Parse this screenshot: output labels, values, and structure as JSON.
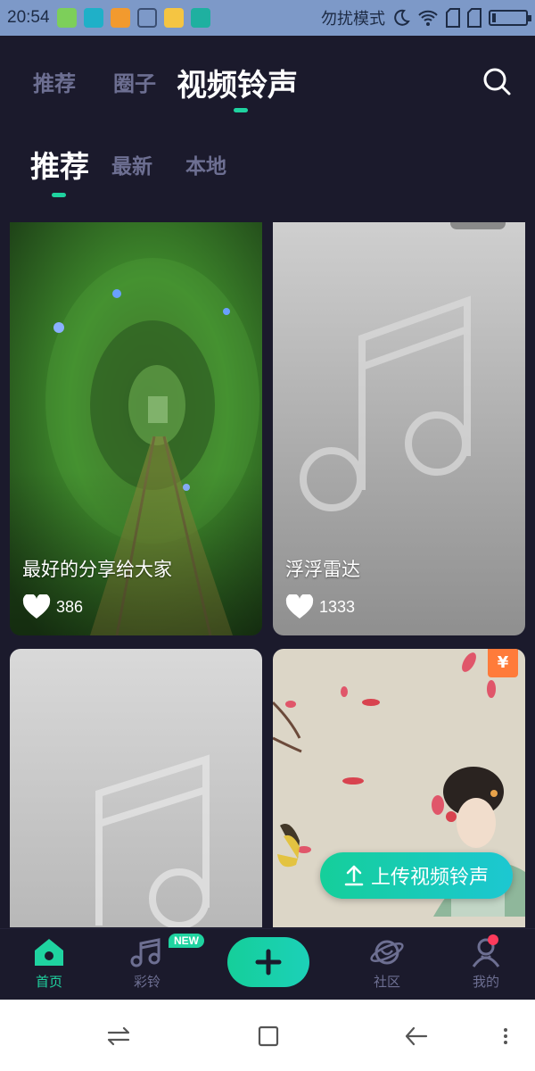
{
  "status_bar": {
    "time": "20:54",
    "dnd_label": "勿扰模式"
  },
  "top_tabs": [
    {
      "label": "推荐"
    },
    {
      "label": "圈子"
    },
    {
      "label": "视频铃声"
    }
  ],
  "sub_tabs": [
    {
      "label": "推荐"
    },
    {
      "label": "最新"
    },
    {
      "label": "本地"
    }
  ],
  "feed": {
    "cards": [
      {
        "title": "最好的分享给大家",
        "likes": "386"
      },
      {
        "title": "浮浮雷达",
        "likes": "1333"
      },
      {
        "title": "",
        "likes": ""
      },
      {
        "title": "",
        "likes": "",
        "price_badge": "¥"
      }
    ]
  },
  "upload_button": {
    "label": "上传视频铃声"
  },
  "bottom_nav": {
    "items": [
      {
        "label": "首页"
      },
      {
        "label": "彩铃"
      },
      {
        "label": "社区"
      },
      {
        "label": "我的"
      }
    ],
    "new_badge": "NEW"
  },
  "colors": {
    "accent": "#1fd3a0",
    "background": "#1b1a2c",
    "inactive_text": "#6d6f92",
    "status_bar": "#7d99c8"
  }
}
